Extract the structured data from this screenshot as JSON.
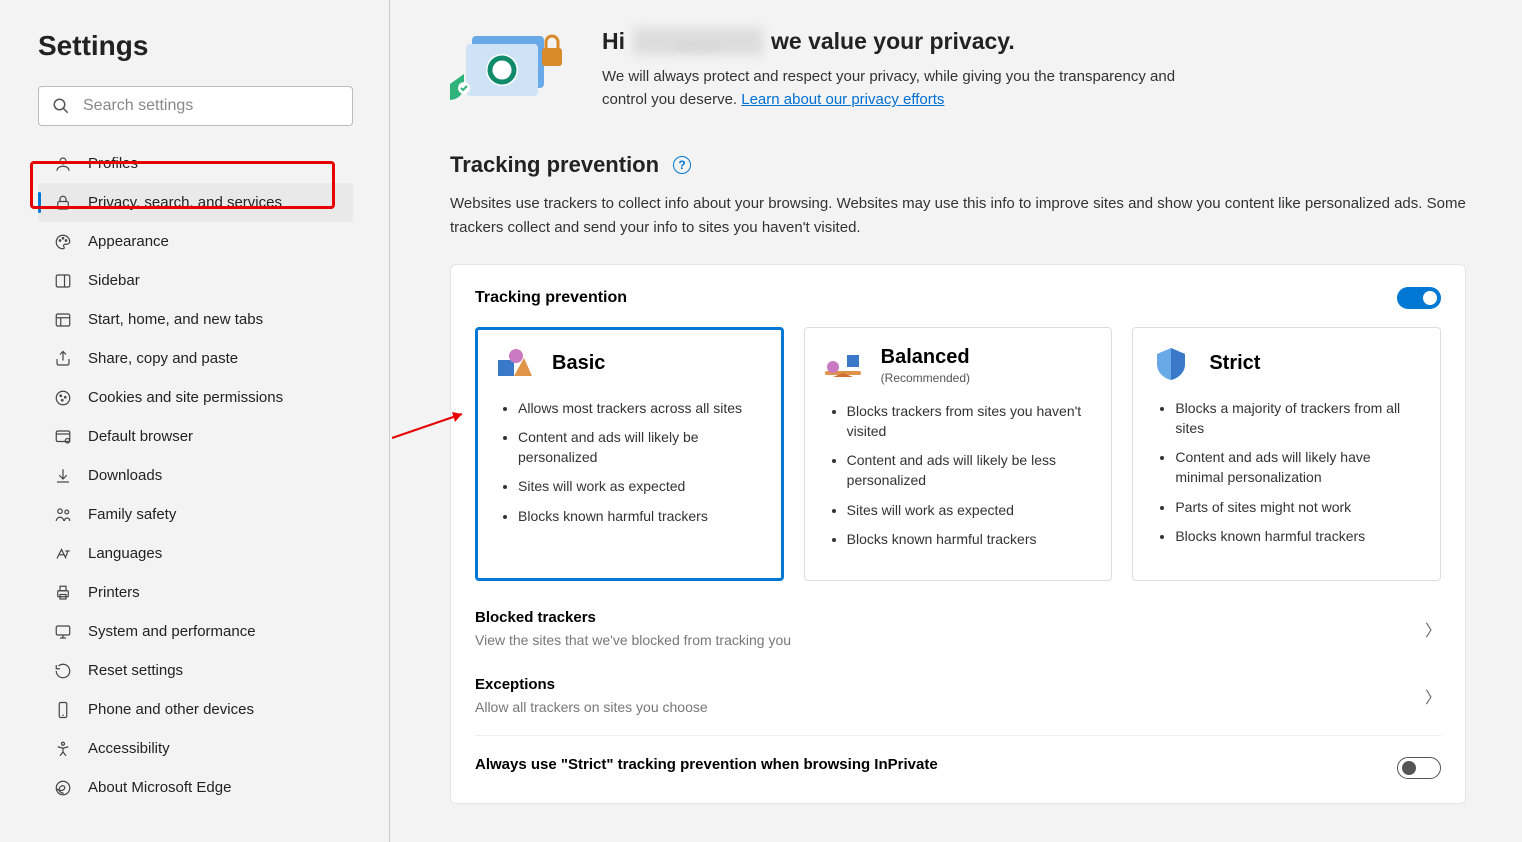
{
  "page_title": "Settings",
  "search": {
    "placeholder": "Search settings"
  },
  "sidebar": {
    "items": [
      {
        "id": "profiles",
        "label": "Profiles",
        "icon": "profile-icon"
      },
      {
        "id": "privacy",
        "label": "Privacy, search, and services",
        "icon": "lock-icon",
        "active": true
      },
      {
        "id": "appearance",
        "label": "Appearance",
        "icon": "palette-icon"
      },
      {
        "id": "sidebar",
        "label": "Sidebar",
        "icon": "sidebar-icon"
      },
      {
        "id": "start",
        "label": "Start, home, and new tabs",
        "icon": "grid-icon"
      },
      {
        "id": "share",
        "label": "Share, copy and paste",
        "icon": "share-icon"
      },
      {
        "id": "cookies",
        "label": "Cookies and site permissions",
        "icon": "cookies-icon"
      },
      {
        "id": "default",
        "label": "Default browser",
        "icon": "default-browser-icon"
      },
      {
        "id": "downloads",
        "label": "Downloads",
        "icon": "download-icon"
      },
      {
        "id": "family",
        "label": "Family safety",
        "icon": "family-icon"
      },
      {
        "id": "languages",
        "label": "Languages",
        "icon": "languages-icon"
      },
      {
        "id": "printers",
        "label": "Printers",
        "icon": "printer-icon"
      },
      {
        "id": "system",
        "label": "System and performance",
        "icon": "system-icon"
      },
      {
        "id": "reset",
        "label": "Reset settings",
        "icon": "reset-icon"
      },
      {
        "id": "phone",
        "label": "Phone and other devices",
        "icon": "phone-icon"
      },
      {
        "id": "accessibility",
        "label": "Accessibility",
        "icon": "accessibility-icon"
      },
      {
        "id": "about",
        "label": "About Microsoft Edge",
        "icon": "edge-icon"
      }
    ]
  },
  "hero": {
    "greeting_prefix": "Hi",
    "greeting_suffix": "we value your privacy.",
    "blurred_name": "……",
    "body": "We will always protect and respect your privacy, while giving you the transparency and control you deserve. ",
    "link": "Learn about our privacy efforts"
  },
  "tracking": {
    "title": "Tracking prevention",
    "desc": "Websites use trackers to collect info about your browsing. Websites may use this info to improve sites and show you content like personalized ads. Some trackers collect and send your info to sites you haven't visited.",
    "card_title": "Tracking prevention",
    "enabled": true,
    "levels": [
      {
        "id": "basic",
        "title": "Basic",
        "subtitle": "",
        "selected": true,
        "points": [
          "Allows most trackers across all sites",
          "Content and ads will likely be personalized",
          "Sites will work as expected",
          "Blocks known harmful trackers"
        ]
      },
      {
        "id": "balanced",
        "title": "Balanced",
        "subtitle": "(Recommended)",
        "selected": false,
        "points": [
          "Blocks trackers from sites you haven't visited",
          "Content and ads will likely be less personalized",
          "Sites will work as expected",
          "Blocks known harmful trackers"
        ]
      },
      {
        "id": "strict",
        "title": "Strict",
        "subtitle": "",
        "selected": false,
        "points": [
          "Blocks a majority of trackers from all sites",
          "Content and ads will likely have minimal personalization",
          "Parts of sites might not work",
          "Blocks known harmful trackers"
        ]
      }
    ],
    "blocked": {
      "title": "Blocked trackers",
      "desc": "View the sites that we've blocked from tracking you"
    },
    "exceptions": {
      "title": "Exceptions",
      "desc": "Allow all trackers on sites you choose"
    },
    "strict_inprivate": {
      "label": "Always use \"Strict\" tracking prevention when browsing InPrivate",
      "enabled": false
    }
  },
  "annotations": {
    "highlight_sidebar_privacy": true,
    "arrow_to_basic": true
  }
}
